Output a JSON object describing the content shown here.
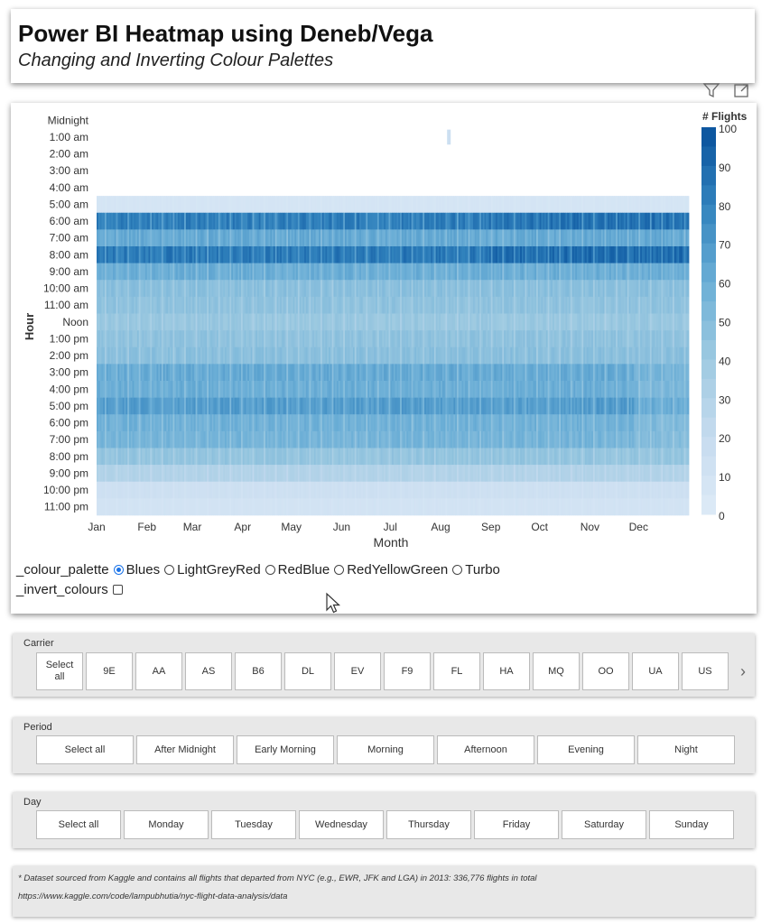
{
  "header": {
    "title": "Power BI Heatmap using Deneb/Vega",
    "subtitle": "Changing and Inverting Colour Palettes"
  },
  "visual_icons": [
    "filter-icon",
    "focus-mode-icon"
  ],
  "chart_data": {
    "type": "heatmap",
    "xlabel": "Month",
    "ylabel": "Hour",
    "x_ticks": [
      "Jan",
      "Feb",
      "Mar",
      "Apr",
      "May",
      "Jun",
      "Jul",
      "Aug",
      "Sep",
      "Oct",
      "Nov",
      "Dec"
    ],
    "y_ticks": [
      "Midnight",
      "1:00 am",
      "2:00 am",
      "3:00 am",
      "4:00 am",
      "5:00 am",
      "6:00 am",
      "7:00 am",
      "8:00 am",
      "9:00 am",
      "10:00 am",
      "11:00 am",
      "Noon",
      "1:00 pm",
      "2:00 pm",
      "3:00 pm",
      "4:00 pm",
      "5:00 pm",
      "6:00 pm",
      "7:00 pm",
      "8:00 pm",
      "9:00 pm",
      "10:00 pm",
      "11:00 pm"
    ],
    "legend": {
      "title": "# Flights",
      "ticks": [
        "100",
        "90",
        "80",
        "70",
        "60",
        "50",
        "40",
        "30",
        "20",
        "10",
        "0"
      ],
      "min": 0,
      "max": 100,
      "placement": "right"
    },
    "color_scheme": "blues",
    "hourly_typical_flights": [
      0,
      2,
      0,
      0,
      0,
      8,
      82,
      62,
      84,
      60,
      48,
      46,
      42,
      46,
      48,
      62,
      60,
      68,
      58,
      56,
      44,
      30,
      14,
      10
    ],
    "notes": "Daily columns across 2013; hour 1:00 am has a single flight in early August"
  },
  "parameters": {
    "palette_label": "_colour_palette",
    "palette_options": [
      {
        "label": "Blues",
        "selected": true
      },
      {
        "label": "LightGreyRed",
        "selected": false
      },
      {
        "label": "RedBlue",
        "selected": false
      },
      {
        "label": "RedYellowGreen",
        "selected": false
      },
      {
        "label": "Turbo",
        "selected": false
      }
    ],
    "invert_label": "_invert_colours",
    "invert_checked": false
  },
  "slicers": {
    "carrier": {
      "label": "Carrier",
      "items": [
        "Select all",
        "9E",
        "AA",
        "AS",
        "B6",
        "DL",
        "EV",
        "F9",
        "FL",
        "HA",
        "MQ",
        "OO",
        "UA",
        "US"
      ]
    },
    "period": {
      "label": "Period",
      "items": [
        "Select all",
        "After Midnight",
        "Early Morning",
        "Morning",
        "Afternoon",
        "Evening",
        "Night"
      ]
    },
    "day": {
      "label": "Day",
      "items": [
        "Select all",
        "Monday",
        "Tuesday",
        "Wednesday",
        "Thursday",
        "Friday",
        "Saturday",
        "Sunday"
      ]
    }
  },
  "footnote": {
    "line1": "* Dataset sourced from Kaggle and contains all flights that departed from NYC (e.g., EWR, JFK and LGA) in 2013: 336,776 flights in total",
    "line2": "https://www.kaggle.com/code/lampubhutia/nyc-flight-data-analysis/data"
  }
}
